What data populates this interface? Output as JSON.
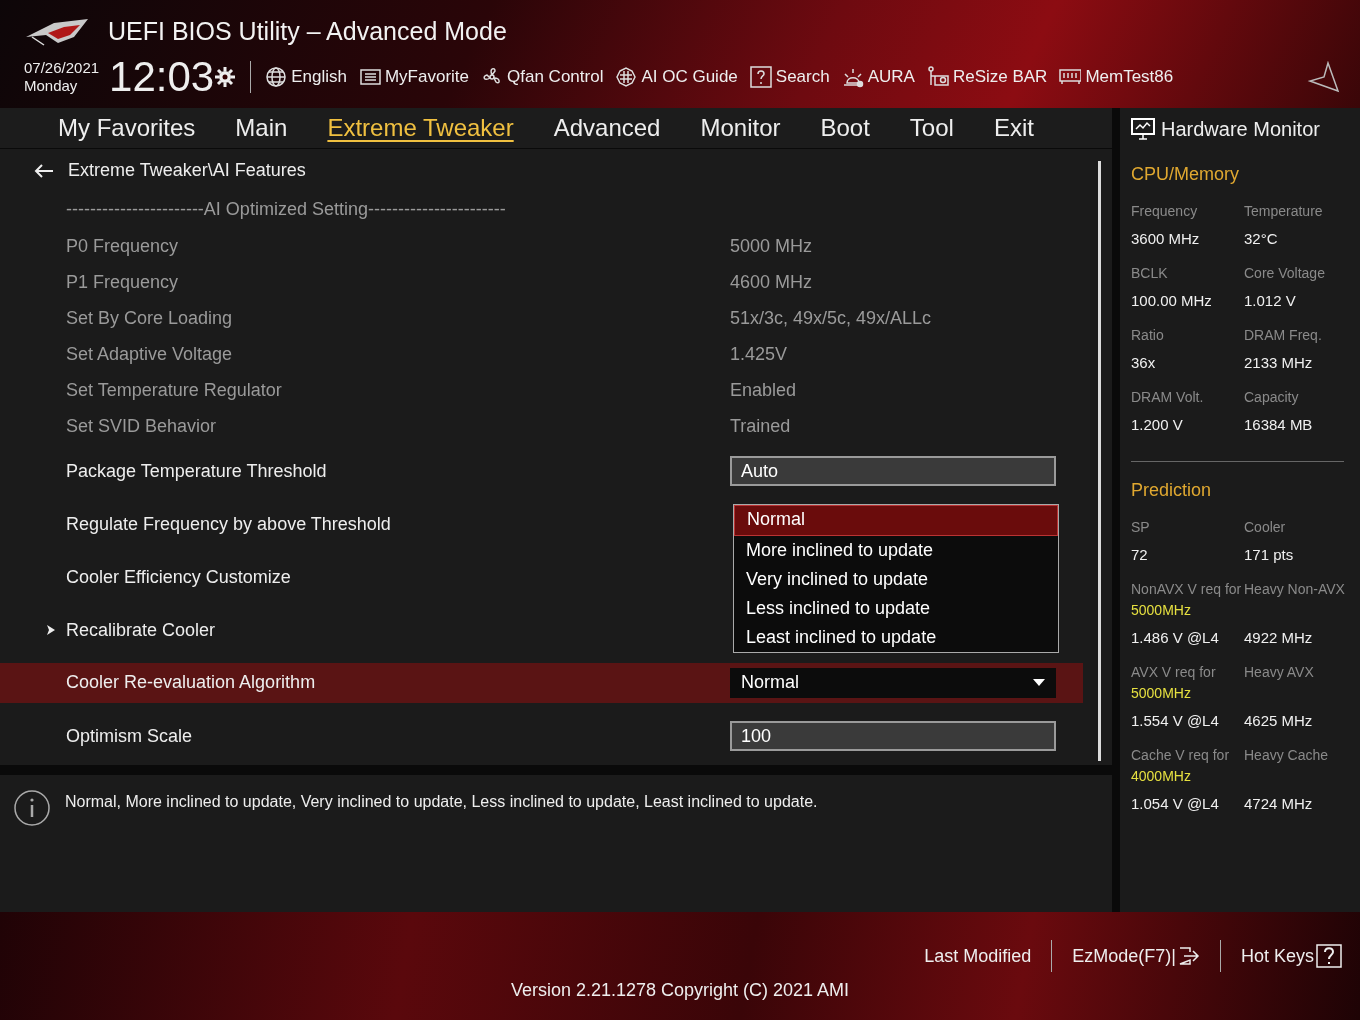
{
  "window": {
    "title": "UEFI BIOS Utility – Advanced Mode"
  },
  "clock": {
    "date": "07/26/2021",
    "day": "Monday",
    "time": "12:03"
  },
  "toolbar": [
    {
      "kind": "globe",
      "label": "English"
    },
    {
      "kind": "favorite",
      "label": "MyFavorite"
    },
    {
      "kind": "fan",
      "label": "Qfan Control"
    },
    {
      "kind": "chip",
      "label": "AI OC Guide"
    },
    {
      "kind": "search",
      "label": "Search"
    },
    {
      "kind": "aura",
      "label": "AURA"
    },
    {
      "kind": "card",
      "label": "ReSize BAR"
    },
    {
      "kind": "memory",
      "label": "MemTest86"
    }
  ],
  "tabs": [
    {
      "label": "My Favorites",
      "selected": false
    },
    {
      "label": "Main",
      "selected": false
    },
    {
      "label": "Extreme Tweaker",
      "selected": true
    },
    {
      "label": "Advanced",
      "selected": false
    },
    {
      "label": "Monitor",
      "selected": false
    },
    {
      "label": "Boot",
      "selected": false
    },
    {
      "label": "Tool",
      "selected": false
    },
    {
      "label": "Exit",
      "selected": false
    }
  ],
  "breadcrumb": "Extreme Tweaker\\AI Features",
  "settings": [
    {
      "kind": "heading",
      "label": "-----------------------AI Optimized Setting-----------------------",
      "selected": false
    },
    {
      "kind": "info",
      "label": "P0 Frequency",
      "value": "5000 MHz",
      "selected": false
    },
    {
      "kind": "info",
      "label": "P1 Frequency",
      "value": "4600 MHz",
      "selected": false
    },
    {
      "kind": "info",
      "label": "Set By Core Loading",
      "value": "51x/3c, 49x/5c, 49x/ALLc",
      "selected": false
    },
    {
      "kind": "info",
      "label": "Set Adaptive Voltage",
      "value": "1.425V",
      "selected": false
    },
    {
      "kind": "info",
      "label": "Set Temperature Regulator",
      "value": "Enabled",
      "selected": false
    },
    {
      "kind": "info",
      "label": "Set SVID Behavior",
      "value": "Trained",
      "selected": false
    },
    {
      "kind": "field",
      "label": "Package Temperature Threshold",
      "value": "Auto",
      "selected": false
    },
    {
      "kind": "setting",
      "label": "Regulate Frequency by above Threshold",
      "selected": false
    },
    {
      "kind": "setting",
      "label": "Cooler Efficiency Customize",
      "selected": false
    },
    {
      "kind": "submenu",
      "label": "Recalibrate Cooler",
      "selected": false
    },
    {
      "kind": "dropdown",
      "label": "Cooler Re-evaluation Algorithm",
      "value": "Normal",
      "selected": true,
      "options": [
        {
          "label": "Normal",
          "selected": true
        },
        {
          "label": "More inclined to update",
          "selected": false
        },
        {
          "label": "Very inclined to update",
          "selected": false
        },
        {
          "label": "Less inclined to update",
          "selected": false
        },
        {
          "label": "Least inclined to update",
          "selected": false
        }
      ]
    },
    {
      "kind": "field",
      "label": "Optimism Scale",
      "value": "100",
      "selected": false
    }
  ],
  "help": "Normal, More inclined to update, Very inclined to update, Less inclined to update, Least inclined to update.",
  "monitor": {
    "title": "Hardware Monitor",
    "sections": [
      {
        "title": "CPU/Memory",
        "items": [
          {
            "label": "Frequency",
            "value": "3600 MHz"
          },
          {
            "label": "Temperature",
            "value": "32°C"
          },
          {
            "label": "BCLK",
            "value": "100.00 MHz"
          },
          {
            "label": "Core Voltage",
            "value": "1.012 V"
          },
          {
            "label": "Ratio",
            "value": "36x"
          },
          {
            "label": "DRAM Freq.",
            "value": "2133 MHz"
          },
          {
            "label": "DRAM Volt.",
            "value": "1.200 V"
          },
          {
            "label": "Capacity",
            "value": "16384 MB"
          }
        ]
      },
      {
        "title": "Prediction",
        "items": [
          {
            "label": "SP",
            "value": "72"
          },
          {
            "label": "Cooler",
            "value": "171 pts"
          },
          {
            "label": "NonAVX V req for",
            "highlight": "5000MHz",
            "value": "1.486 V @L4"
          },
          {
            "label": "Heavy Non-AVX",
            "value": "4922 MHz"
          },
          {
            "label": "AVX V req for",
            "highlight": "5000MHz",
            "value": "1.554 V @L4"
          },
          {
            "label": "Heavy AVX",
            "value": "4625 MHz"
          },
          {
            "label": "Cache V req for",
            "highlight": "4000MHz",
            "value": "1.054 V @L4"
          },
          {
            "label": "Heavy Cache",
            "value": "4724 MHz"
          }
        ]
      }
    ]
  },
  "footer": {
    "items": [
      {
        "kind": "text",
        "label": "Last Modified"
      },
      {
        "kind": "exit",
        "label": "EzMode(F7)|"
      },
      {
        "kind": "help",
        "label": "Hot Keys"
      }
    ],
    "version": "Version 2.21.1278 Copyright (C) 2021 AMI"
  }
}
